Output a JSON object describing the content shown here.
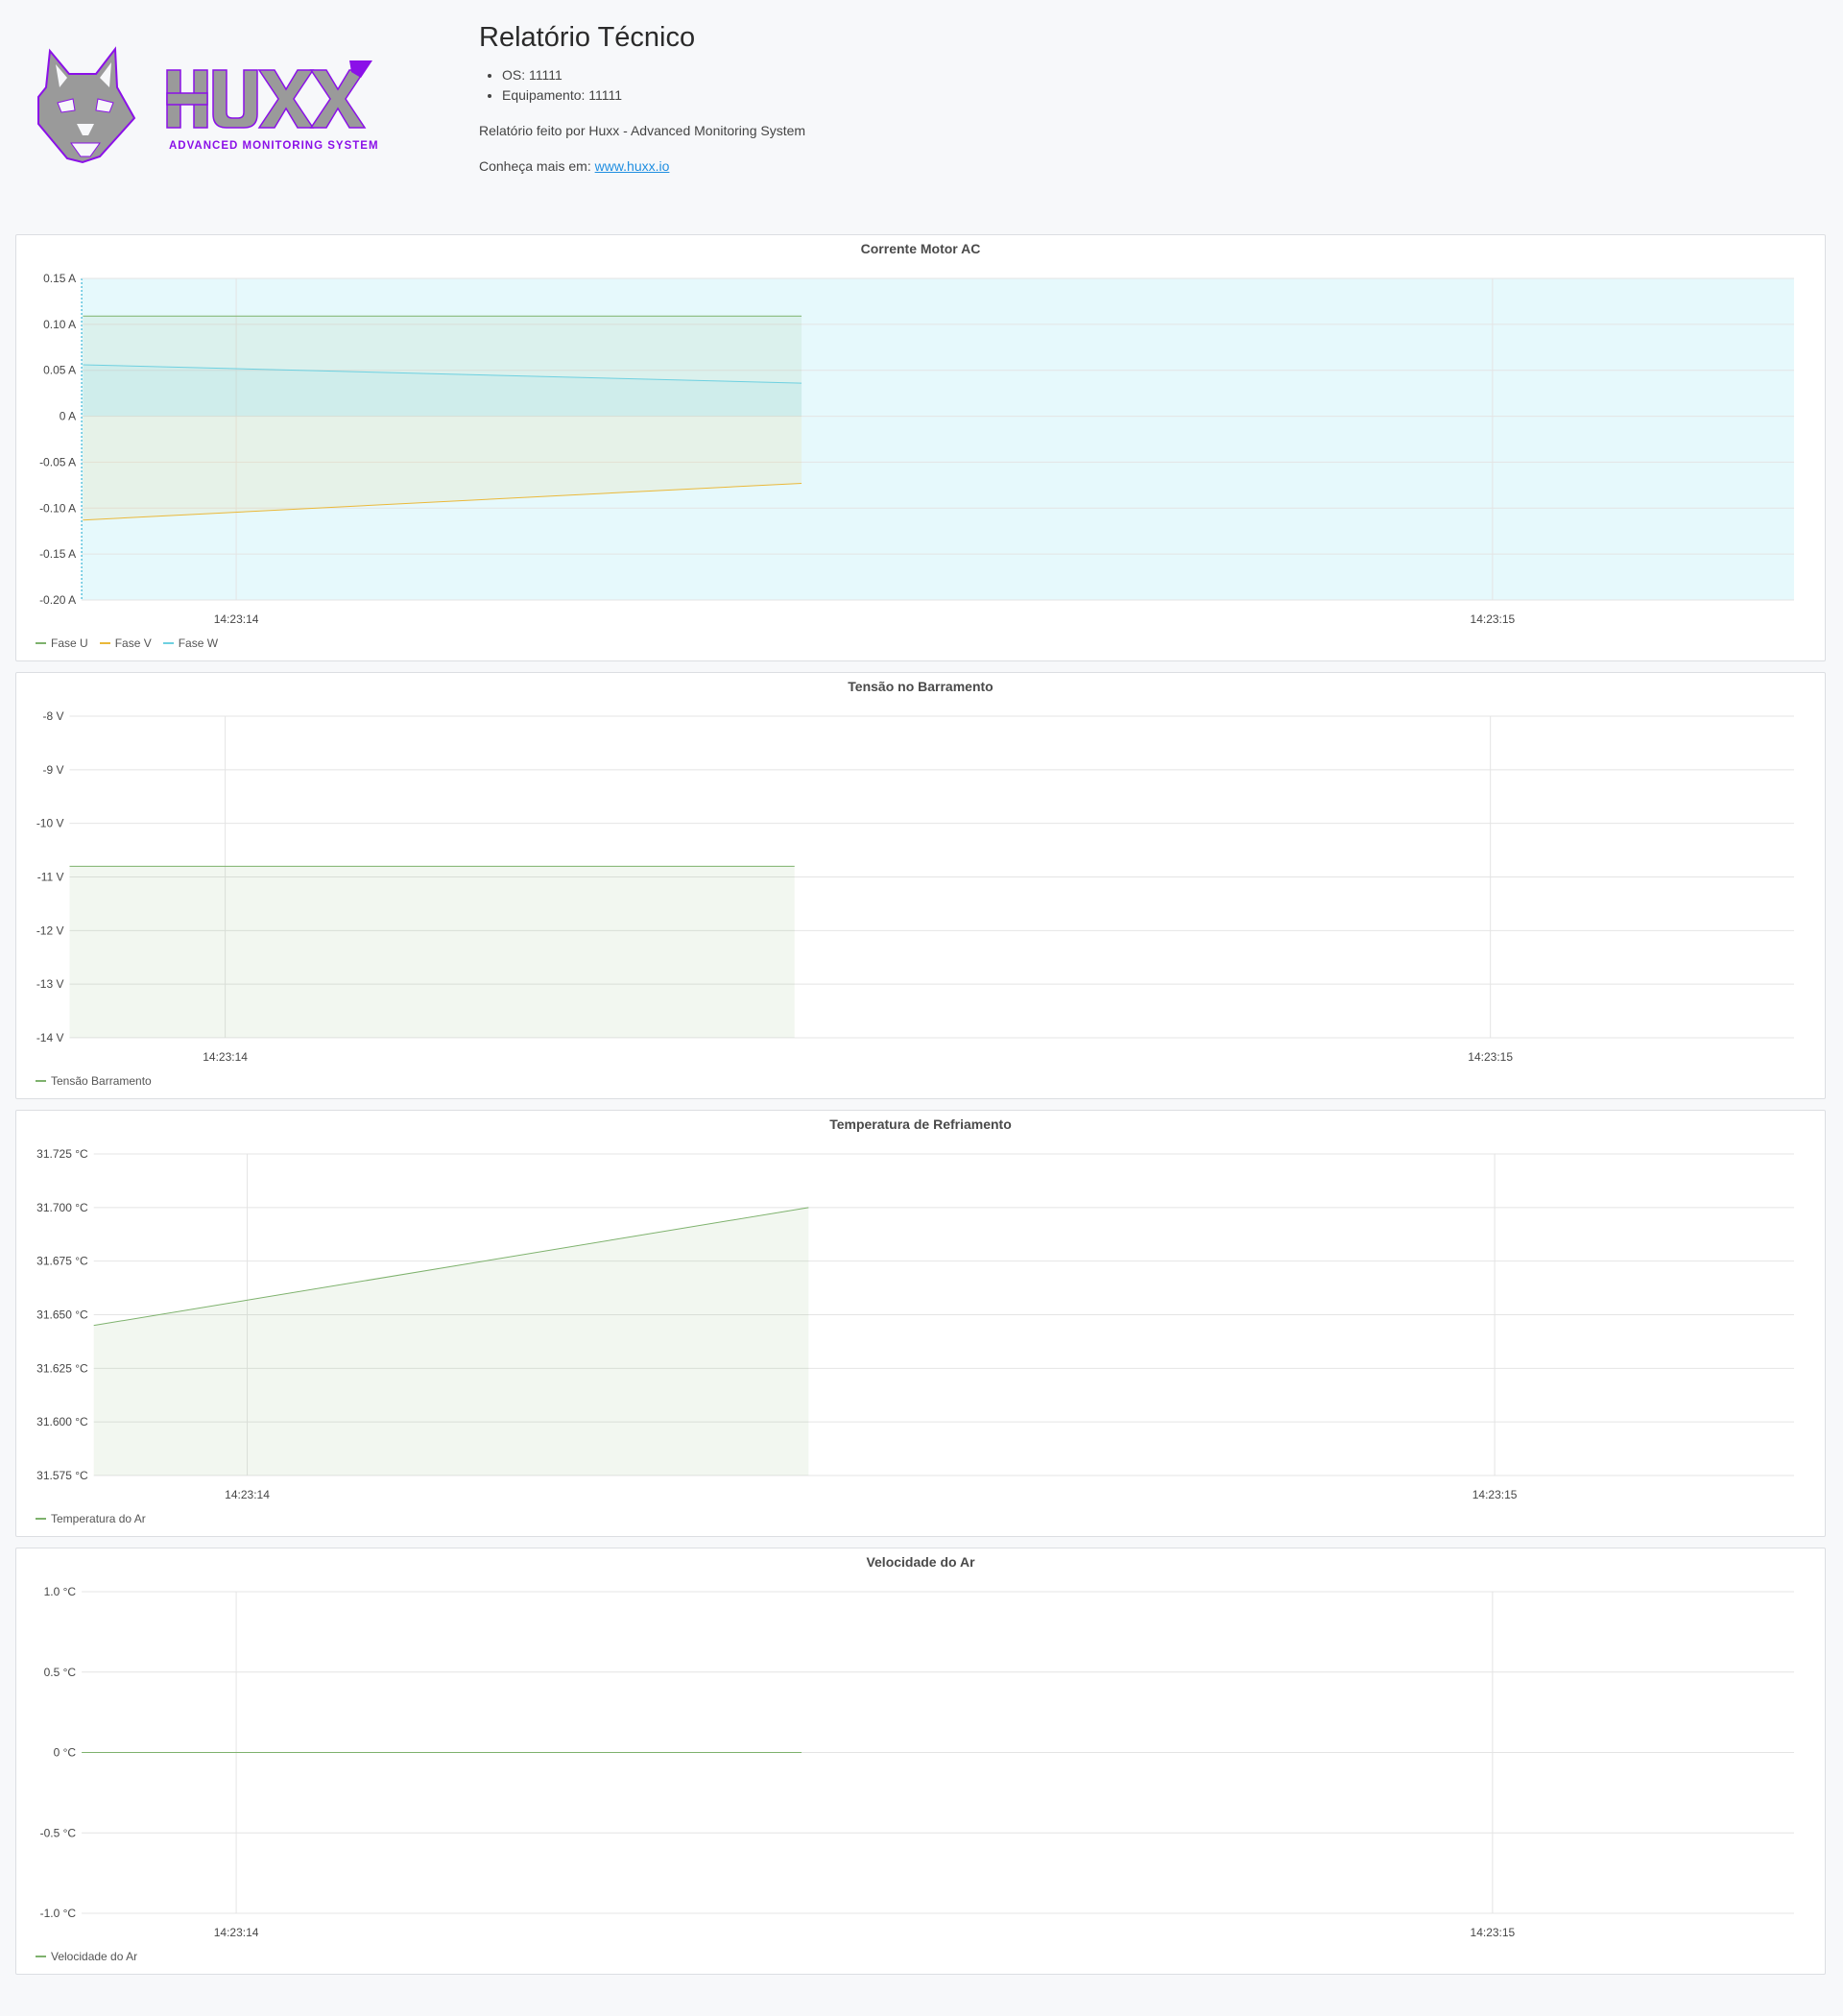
{
  "header": {
    "logo": {
      "brand": "HUXX",
      "tagline": "ADVANCED MONITORING SYSTEM",
      "colors": {
        "gray": "#9a9a9a",
        "purple": "#8b10e8"
      }
    },
    "title": "Relatório Técnico",
    "details": [
      "OS: 11111",
      "Equipamento: 11111"
    ],
    "made_by": "Relatório feito por Huxx - Advanced Monitoring System",
    "more_prefix": "Conheça mais em: ",
    "more_link": "www.huxx.io"
  },
  "chart_data": [
    {
      "type": "line",
      "title": "Corrente Motor AC",
      "y_ticks": [
        "0.15 A",
        "0.10 A",
        "0.05 A",
        "0 A",
        "-0.05 A",
        "-0.10 A",
        "-0.15 A",
        "-0.20 A"
      ],
      "ylim": [
        -0.2,
        0.15
      ],
      "x_ticks": [
        "14:23:14",
        "14:23:15"
      ],
      "xlim": [
        13.877,
        15.24
      ],
      "highlight_background": true,
      "series": [
        {
          "name": "Fase U",
          "color": "#7eb26d",
          "fill": true,
          "x": [
            13.878,
            14.45
          ],
          "y": [
            0.109,
            0.109
          ]
        },
        {
          "name": "Fase V",
          "color": "#eab839",
          "fill": true,
          "x": [
            13.878,
            14.45
          ],
          "y": [
            -0.113,
            -0.073
          ]
        },
        {
          "name": "Fase W",
          "color": "#6ed0e0",
          "fill": true,
          "x": [
            13.878,
            14.45
          ],
          "y": [
            0.056,
            0.036
          ]
        }
      ]
    },
    {
      "type": "line",
      "title": "Tensão no Barramento",
      "y_ticks": [
        "-8 V",
        "-9 V",
        "-10 V",
        "-11 V",
        "-12 V",
        "-13 V",
        "-14 V"
      ],
      "ylim": [
        -14,
        -8
      ],
      "x_ticks": [
        "14:23:14",
        "14:23:15"
      ],
      "xlim": [
        13.877,
        15.24
      ],
      "series": [
        {
          "name": "Tensão Barramento",
          "color": "#7eb26d",
          "fill": true,
          "x": [
            13.877,
            14.45
          ],
          "y": [
            -10.8,
            -10.8
          ]
        }
      ]
    },
    {
      "type": "line",
      "title": "Temperatura de Refriamento",
      "y_ticks": [
        "31.725 °C",
        "31.700 °C",
        "31.675 °C",
        "31.650 °C",
        "31.625 °C",
        "31.600 °C",
        "31.575 °C"
      ],
      "ylim": [
        31.575,
        31.725
      ],
      "x_ticks": [
        "14:23:14",
        "14:23:15"
      ],
      "xlim": [
        13.877,
        15.24
      ],
      "series": [
        {
          "name": "Temperatura do Ar",
          "color": "#7eb26d",
          "fill": true,
          "x": [
            13.877,
            14.45
          ],
          "y": [
            31.645,
            31.7
          ]
        }
      ]
    },
    {
      "type": "line",
      "title": "Velocidade do Ar",
      "y_ticks": [
        "1.0 °C",
        "0.5 °C",
        "0 °C",
        "-0.5 °C",
        "-1.0 °C"
      ],
      "ylim": [
        -1.0,
        1.0
      ],
      "x_ticks": [
        "14:23:14",
        "14:23:15"
      ],
      "xlim": [
        13.877,
        15.24
      ],
      "series": [
        {
          "name": "Velocidade do Ar",
          "color": "#7eb26d",
          "fill": false,
          "x": [
            13.877,
            14.45
          ],
          "y": [
            0,
            0
          ]
        }
      ]
    }
  ]
}
